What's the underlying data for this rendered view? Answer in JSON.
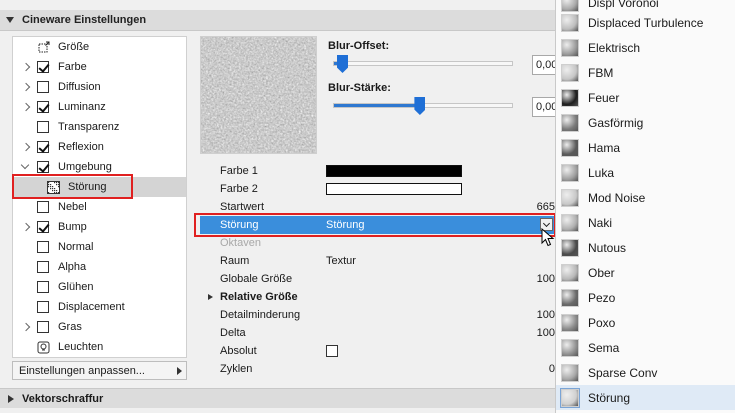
{
  "header": {
    "title": "Cineware Einstellungen"
  },
  "tree": [
    {
      "label": "Größe",
      "expander": "none",
      "checkbox": "none",
      "icon": "resize-icon"
    },
    {
      "label": "Farbe",
      "expander": "closed",
      "checkbox": true
    },
    {
      "label": "Diffusion",
      "expander": "closed",
      "checkbox": false
    },
    {
      "label": "Luminanz",
      "expander": "closed",
      "checkbox": true
    },
    {
      "label": "Transparenz",
      "expander": "none",
      "checkbox": false
    },
    {
      "label": "Reflexion",
      "expander": "closed",
      "checkbox": true
    },
    {
      "label": "Umgebung",
      "expander": "open",
      "checkbox": true
    },
    {
      "label": "Störung",
      "expander": "child",
      "checkbox": "none",
      "icon": "noise-icon",
      "selected": true
    },
    {
      "label": "Nebel",
      "expander": "none",
      "checkbox": false
    },
    {
      "label": "Bump",
      "expander": "closed",
      "checkbox": true
    },
    {
      "label": "Normal",
      "expander": "none",
      "checkbox": false
    },
    {
      "label": "Alpha",
      "expander": "none",
      "checkbox": false
    },
    {
      "label": "Glühen",
      "expander": "none",
      "checkbox": false
    },
    {
      "label": "Displacement",
      "expander": "none",
      "checkbox": false
    },
    {
      "label": "Gras",
      "expander": "closed",
      "checkbox": false
    },
    {
      "label": "Leuchten",
      "expander": "none",
      "checkbox": "none",
      "icon": "light-bulb-icon"
    }
  ],
  "settings_button": {
    "label": "Einstellungen anpassen..."
  },
  "footer": {
    "title": "Vektorschraffur"
  },
  "sliders": {
    "blur_offset": {
      "label": "Blur-Offset:",
      "value": "0,00",
      "level": 0.05
    },
    "blur_strength": {
      "label": "Blur-Stärke:",
      "value": "0,00",
      "level": 0.48
    }
  },
  "props": {
    "farbe1": {
      "key": "Farbe 1",
      "color": "#000000"
    },
    "farbe2": {
      "key": "Farbe 2",
      "color": "#ffffff"
    },
    "startwert": {
      "key": "Startwert",
      "num": "665"
    },
    "stoerung": {
      "key": "Störung",
      "value": "Störung"
    },
    "oktaven": {
      "key": "Oktaven"
    },
    "raum": {
      "key": "Raum",
      "value": "Textur"
    },
    "globale": {
      "key": "Globale Größe",
      "num": "100"
    },
    "relative": {
      "key": "Relative Größe"
    },
    "detail": {
      "key": "Detailminderung",
      "num": "100"
    },
    "delta": {
      "key": "Delta",
      "num": "100"
    },
    "absolut": {
      "key": "Absolut"
    },
    "zyklen": {
      "key": "Zyklen",
      "num": "0"
    }
  },
  "popup": {
    "top_partial": "Displ Voronoi",
    "items": [
      "Displaced Turbulence",
      "Elektrisch",
      "FBM",
      "Feuer",
      "Gasförmig",
      "Hama",
      "Luka",
      "Mod Noise",
      "Naki",
      "Nutous",
      "Ober",
      "Pezo",
      "Poxo",
      "Sema",
      "Sparse Conv",
      "Störung"
    ],
    "selected": "Störung"
  },
  "colors": {
    "accent": "#3a8edc",
    "highlight": "#e02020"
  }
}
